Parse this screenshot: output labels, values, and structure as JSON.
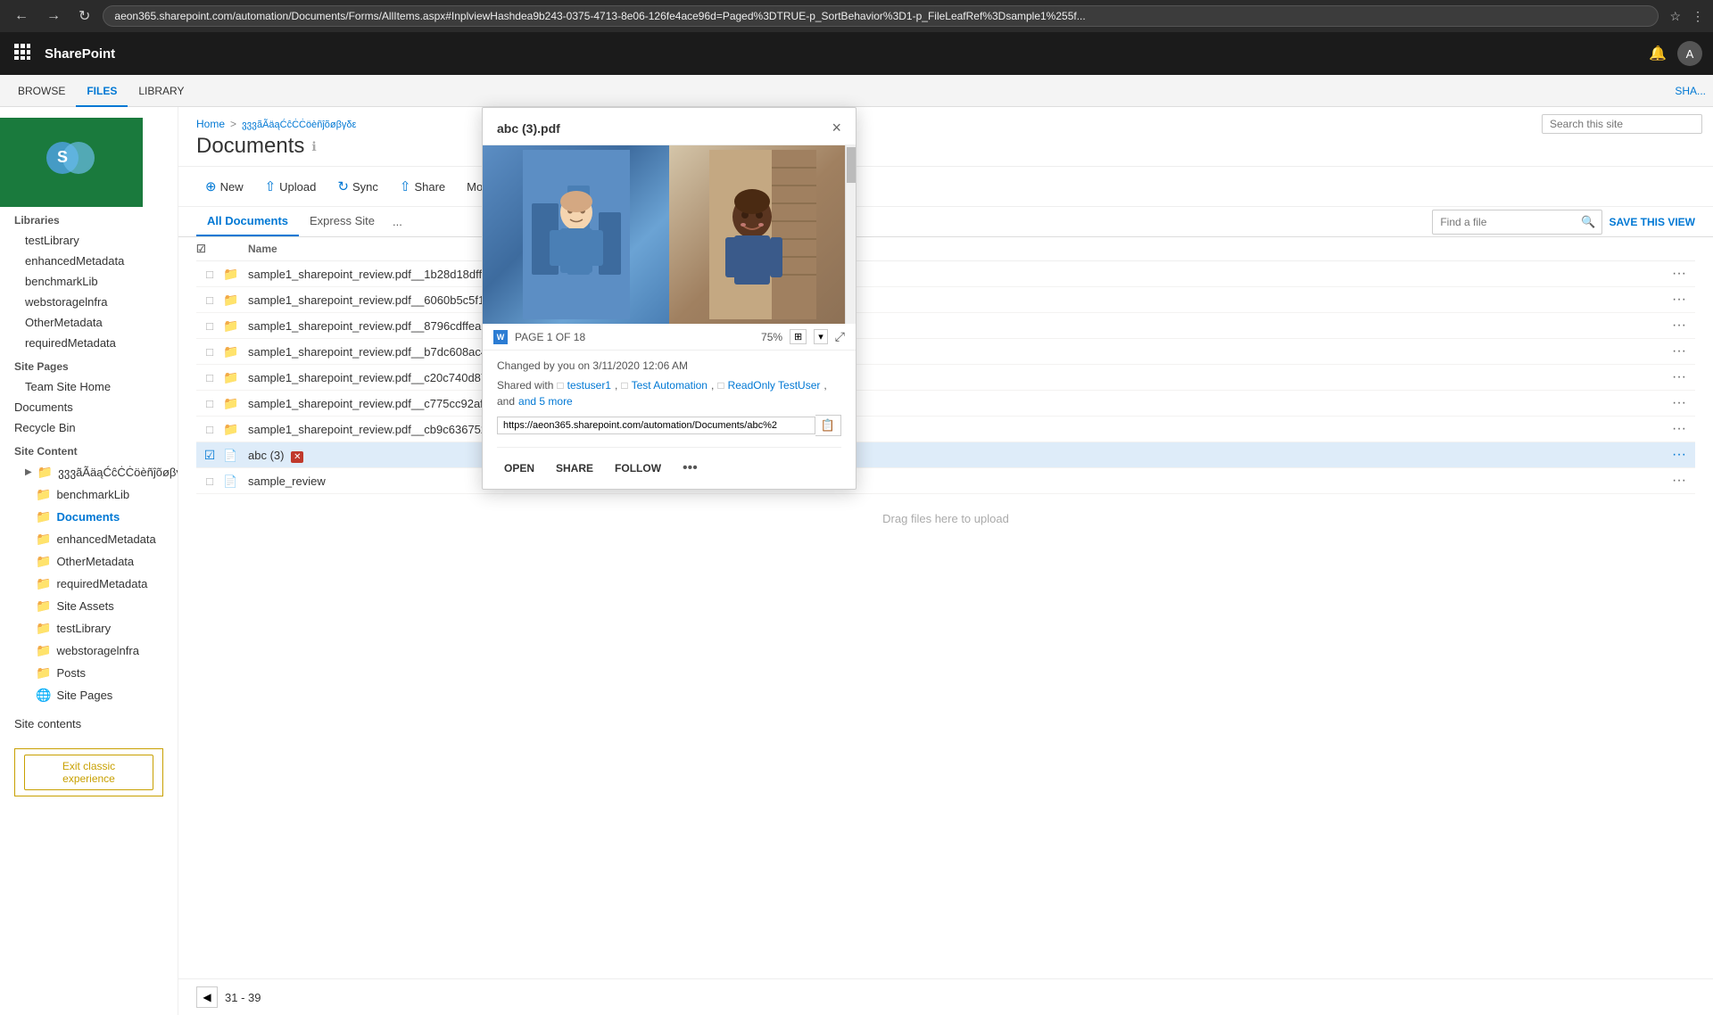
{
  "browser": {
    "url": "aeon365.sharepoint.com/automation/Documents/Forms/AllItems.aspx#InplviewHashdea9b243-0375-4713-8e06-126fe4ace96d=Paged%3DTRUE-p_SortBehavior%3D1-p_FileLeafRef%3Dsample1%255f...",
    "back_title": "Back",
    "forward_title": "Forward",
    "refresh_title": "Refresh"
  },
  "sp_header": {
    "app_launcher": "⊞",
    "title": "SharePoint",
    "bell_icon": "🔔",
    "user_initial": "A"
  },
  "ribbon": {
    "tabs": [
      "BROWSE",
      "FILES",
      "LIBRARY"
    ],
    "active_tab": "FILES",
    "share_label": "SHA..."
  },
  "sidebar": {
    "libraries_label": "Libraries",
    "libraries_items": [
      "testLibrary",
      "enhancedMetadata",
      "benchmarkLib",
      "webstoragelnfra",
      "OtherMetadata",
      "requiredMetadata"
    ],
    "site_pages_label": "Site Pages",
    "site_pages_items": [
      "Team Site Home"
    ],
    "documents_label": "Documents",
    "recycle_bin_label": "Recycle Bin",
    "site_content_label": "Site Content",
    "site_content_items": [
      {
        "label": "ვვვãÃäąĆĉĊĊöèñĵõøβγδε",
        "indent": 1,
        "has_arrow": true
      },
      {
        "label": "benchmarkLib",
        "indent": 2
      },
      {
        "label": "Documents",
        "indent": 2,
        "active": true
      },
      {
        "label": "enhancedMetadata",
        "indent": 2
      },
      {
        "label": "OtherMetadata",
        "indent": 2
      },
      {
        "label": "requiredMetadata",
        "indent": 2
      },
      {
        "label": "Site Assets",
        "indent": 2
      },
      {
        "label": "testLibrary",
        "indent": 2
      },
      {
        "label": "webstoragelnfra",
        "indent": 2
      },
      {
        "label": "Posts",
        "indent": 2
      },
      {
        "label": "Site Pages",
        "indent": 2
      }
    ],
    "site_contents_label": "Site contents"
  },
  "page_header": {
    "breadcrumb_home": "Home",
    "breadcrumb_sep": ">",
    "breadcrumb_site": "ვვვãÃäąĆĉĊĊöèñĵõøβγδε",
    "title": "Documents",
    "info_icon": "ℹ"
  },
  "toolbar": {
    "new_label": "New",
    "upload_label": "Upload",
    "sync_label": "Sync",
    "share_label": "Share",
    "more_label": "More",
    "more_chevron": "▾"
  },
  "view_tabs": {
    "all_documents": "All Documents",
    "express_site": "Express Site",
    "more": "...",
    "find_placeholder": "Find a file",
    "save_view": "SAVE THIS VIEW"
  },
  "file_list": {
    "headers": [
      "Name"
    ],
    "files": [
      {
        "name": "sample1_sharepoint_review.pdf__1b28d18dff6337489171766faba2519f",
        "icon": "📁",
        "type": "folder"
      },
      {
        "name": "sample1_sharepoint_review.pdf__6060b5c5f16a274d8eae8c30d755b3ca",
        "icon": "📁",
        "type": "folder"
      },
      {
        "name": "sample1_sharepoint_review.pdf__8796cdffeae57d45958298a12147ebb9",
        "icon": "📁",
        "type": "folder"
      },
      {
        "name": "sample1_sharepoint_review.pdf__b7dc608ac40b9847bdaae03e13885a87",
        "icon": "📁",
        "type": "folder"
      },
      {
        "name": "sample1_sharepoint_review.pdf__c20c740d87a9a74486389cdee749aede",
        "icon": "📁",
        "type": "folder"
      },
      {
        "name": "sample1_sharepoint_review.pdf__c775cc92afa6ef4b8811a97e64544735",
        "icon": "📁",
        "type": "folder"
      },
      {
        "name": "sample1_sharepoint_review.pdf__cb9c6367523744244bd458ea797b924c2",
        "icon": "📁",
        "type": "folder"
      },
      {
        "name": "abc (3)",
        "icon": "📄",
        "type": "pdf",
        "selected": true,
        "badge": "✕"
      },
      {
        "name": "sample_review",
        "icon": "📄",
        "type": "pdf"
      }
    ],
    "drag_drop_text": "Drag files here to upload"
  },
  "pagination": {
    "prev_icon": "◀",
    "range": "31 - 39"
  },
  "search_site": {
    "placeholder": "Search this site"
  },
  "preview_popup": {
    "title": "abc (3).pdf",
    "close_icon": "×",
    "page_info": "PAGE 1 OF 18",
    "zoom": "75%",
    "word_icon": "W",
    "changed_by": "Changed by you on 3/11/2020 12:06 AM",
    "shared_with_label": "Shared with",
    "shared_users": [
      "testuser1",
      "Test Automation",
      "ReadOnly TestUser"
    ],
    "and_more": "and 5 more",
    "url": "https://aeon365.sharepoint.com/automation/Documents/abc%2",
    "copy_icon": "📋",
    "open_label": "OPEN",
    "share_label": "SHARE",
    "follow_label": "FOLLOW",
    "more_icon": "•••"
  },
  "bottom_bar": {
    "exit_classic": "Exit classic experience"
  },
  "colors": {
    "accent": "#0078d4",
    "header_bg": "#1b1b1b",
    "selected_row": "#deecf9",
    "folder_color": "#dcb67a",
    "site_logo_bg": "#1a7a3d"
  }
}
